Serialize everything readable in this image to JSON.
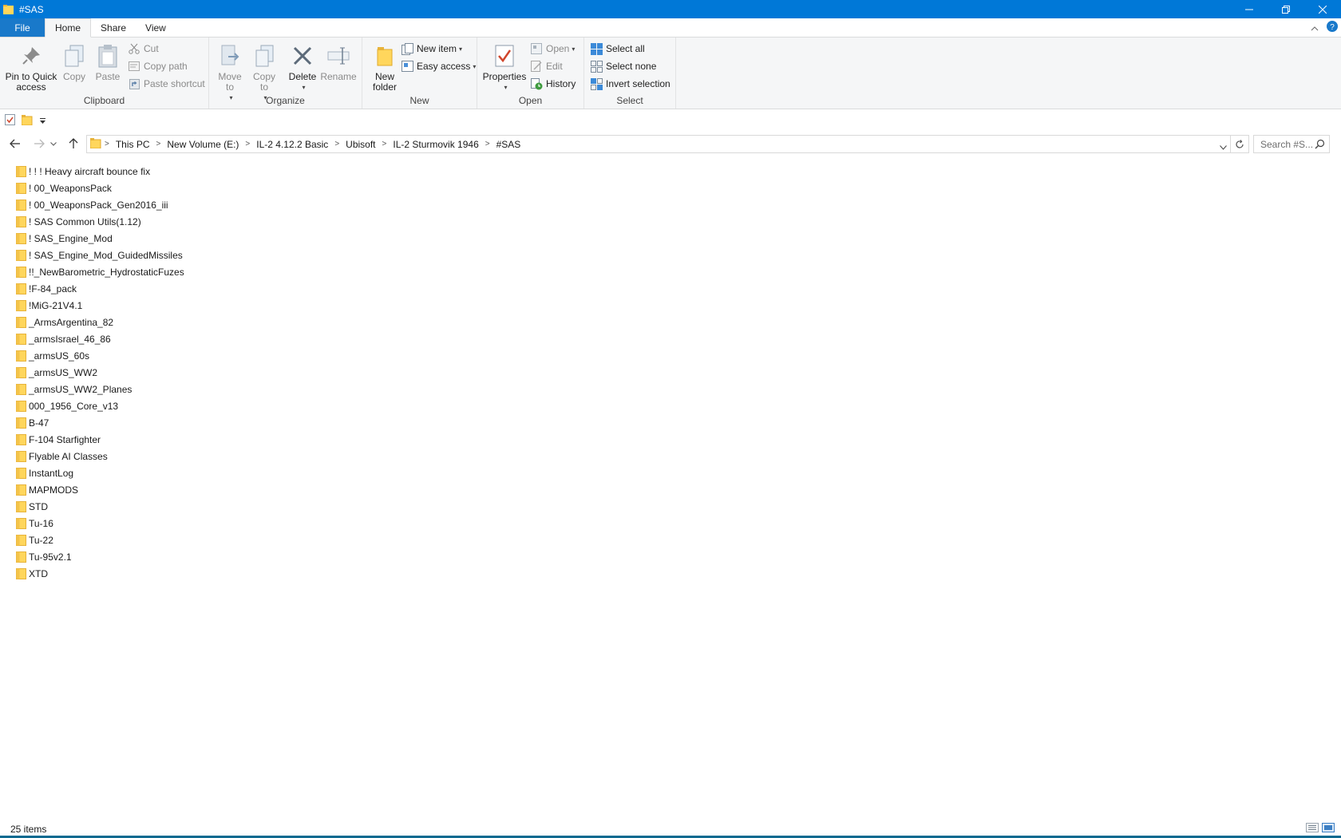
{
  "window": {
    "title": "#SAS"
  },
  "ribbon_tabs": [
    "File",
    "Home",
    "Share",
    "View"
  ],
  "ribbon": {
    "clipboard": {
      "label": "Clipboard",
      "pin": "Pin to Quick access",
      "copy": "Copy",
      "paste": "Paste",
      "cut": "Cut",
      "copy_path": "Copy path",
      "paste_shortcut": "Paste shortcut"
    },
    "organize": {
      "label": "Organize",
      "move_to": "Move to",
      "copy_to": "Copy to",
      "delete": "Delete",
      "rename": "Rename"
    },
    "new": {
      "label": "New",
      "new_folder": "New folder",
      "new_item": "New item",
      "easy_access": "Easy access"
    },
    "open": {
      "label": "Open",
      "properties": "Properties",
      "open": "Open",
      "edit": "Edit",
      "history": "History"
    },
    "select": {
      "label": "Select",
      "select_all": "Select all",
      "select_none": "Select none",
      "invert_selection": "Invert selection"
    }
  },
  "breadcrumb": [
    "This PC",
    "New Volume (E:)",
    "IL-2 4.12.2 Basic",
    "Ubisoft",
    "IL-2 Sturmovik 1946",
    "#SAS"
  ],
  "search": {
    "placeholder": "Search #S..."
  },
  "files": [
    "! ! ! Heavy aircraft bounce fix",
    "! 00_WeaponsPack",
    "! 00_WeaponsPack_Gen2016_iii",
    "! SAS Common Utils(1.12)",
    "! SAS_Engine_Mod",
    "! SAS_Engine_Mod_GuidedMissiles",
    "!!_NewBarometric_HydrostaticFuzes",
    "!F-84_pack",
    "!MiG-21V4.1",
    "_ArmsArgentina_82",
    "_armsIsrael_46_86",
    "_armsUS_60s",
    "_armsUS_WW2",
    "_armsUS_WW2_Planes",
    "000_1956_Core_v13",
    "B-47",
    "F-104 Starfighter",
    "Flyable AI Classes",
    "InstantLog",
    "MAPMODS",
    "STD",
    "Tu-16",
    "Tu-22",
    "Tu-95v2.1",
    "XTD"
  ],
  "status": {
    "item_count": "25 items"
  },
  "colors": {
    "accent": "#0078d7",
    "folder": "#ffd65c",
    "folder_dark": "#e8b33a"
  }
}
